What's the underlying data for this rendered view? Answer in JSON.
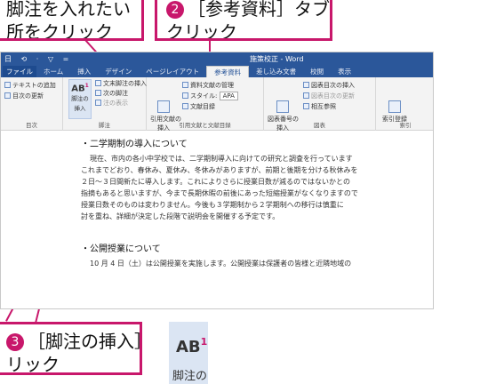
{
  "callouts": {
    "c1": {
      "text_line1": "脚注を入れたい",
      "text_line2": "所をクリック"
    },
    "c2": {
      "num": "2",
      "text_line1": "［参考資料］タブを",
      "text_line2": "クリック"
    },
    "c3": {
      "num": "3",
      "text_line1": "［脚注の挿入］を",
      "text_line2": "リック"
    }
  },
  "window": {
    "title": "施策校正 - Word",
    "qat": "日 ⟲ · ▽ ="
  },
  "tabs": [
    "ファイル",
    "ホーム",
    "挿入",
    "デザイン",
    "ページレイアウト",
    "参考資料",
    "差し込み文書",
    "校閲",
    "表示"
  ],
  "ribbon": {
    "toc_add_text": "テキストの追加",
    "toc_update": "目次の更新",
    "toc_group": "目次",
    "fn_insert_label_1": "脚注の",
    "fn_insert_label_2": "挿入",
    "endnote_insert": "文末脚注の挿入",
    "next_footnote": "次の脚注",
    "show_notes": "注の表示",
    "fn_group": "脚注",
    "citation_manage": "資料文献の管理",
    "style_label": "スタイル:",
    "style_value": "APA",
    "bibliography": "文献目録",
    "citation_insert_1": "引用文献の",
    "citation_insert_2": "挿入",
    "citation_group": "引用文献と文献目録",
    "caption_1": "図表番号の",
    "caption_2": "挿入",
    "table_of_figures": "図表目次の挿入",
    "update_table": "図表目次の更新",
    "cross_ref": "相互参照",
    "caption_group": "図表",
    "index_mark": "索引登録",
    "index_group": "索引"
  },
  "document": {
    "heading1": "・二学期制の導入について",
    "lines": [
      "現在、市内の各小中学校では、二学期制導入に向けての研究と調査を行っています",
      "これまでどおり、春休み、夏休み、冬休みがありますが、前期と後期を分ける秋休みを",
      "２日〜３日間新たに導入します。これによりさらに授業日数が減るのではないかとの",
      "指摘もあると思いますが、今まで長期休暇の前後にあった短縮授業がなくなりますので",
      "授業日数そのものは変わりません。今後も３学期制から２学期制への移行は慎重に",
      "討を重ね、詳細が決定した段階で説明会を開催する予定です。"
    ],
    "heading2": "・公開授業について",
    "line_last": "10 月 4 日（土）は公開授業を実施します。公開授業は保護者の皆様と近隣地域の"
  },
  "zoom": {
    "label": "脚注の",
    "ab": "AB",
    "sup": "1"
  }
}
